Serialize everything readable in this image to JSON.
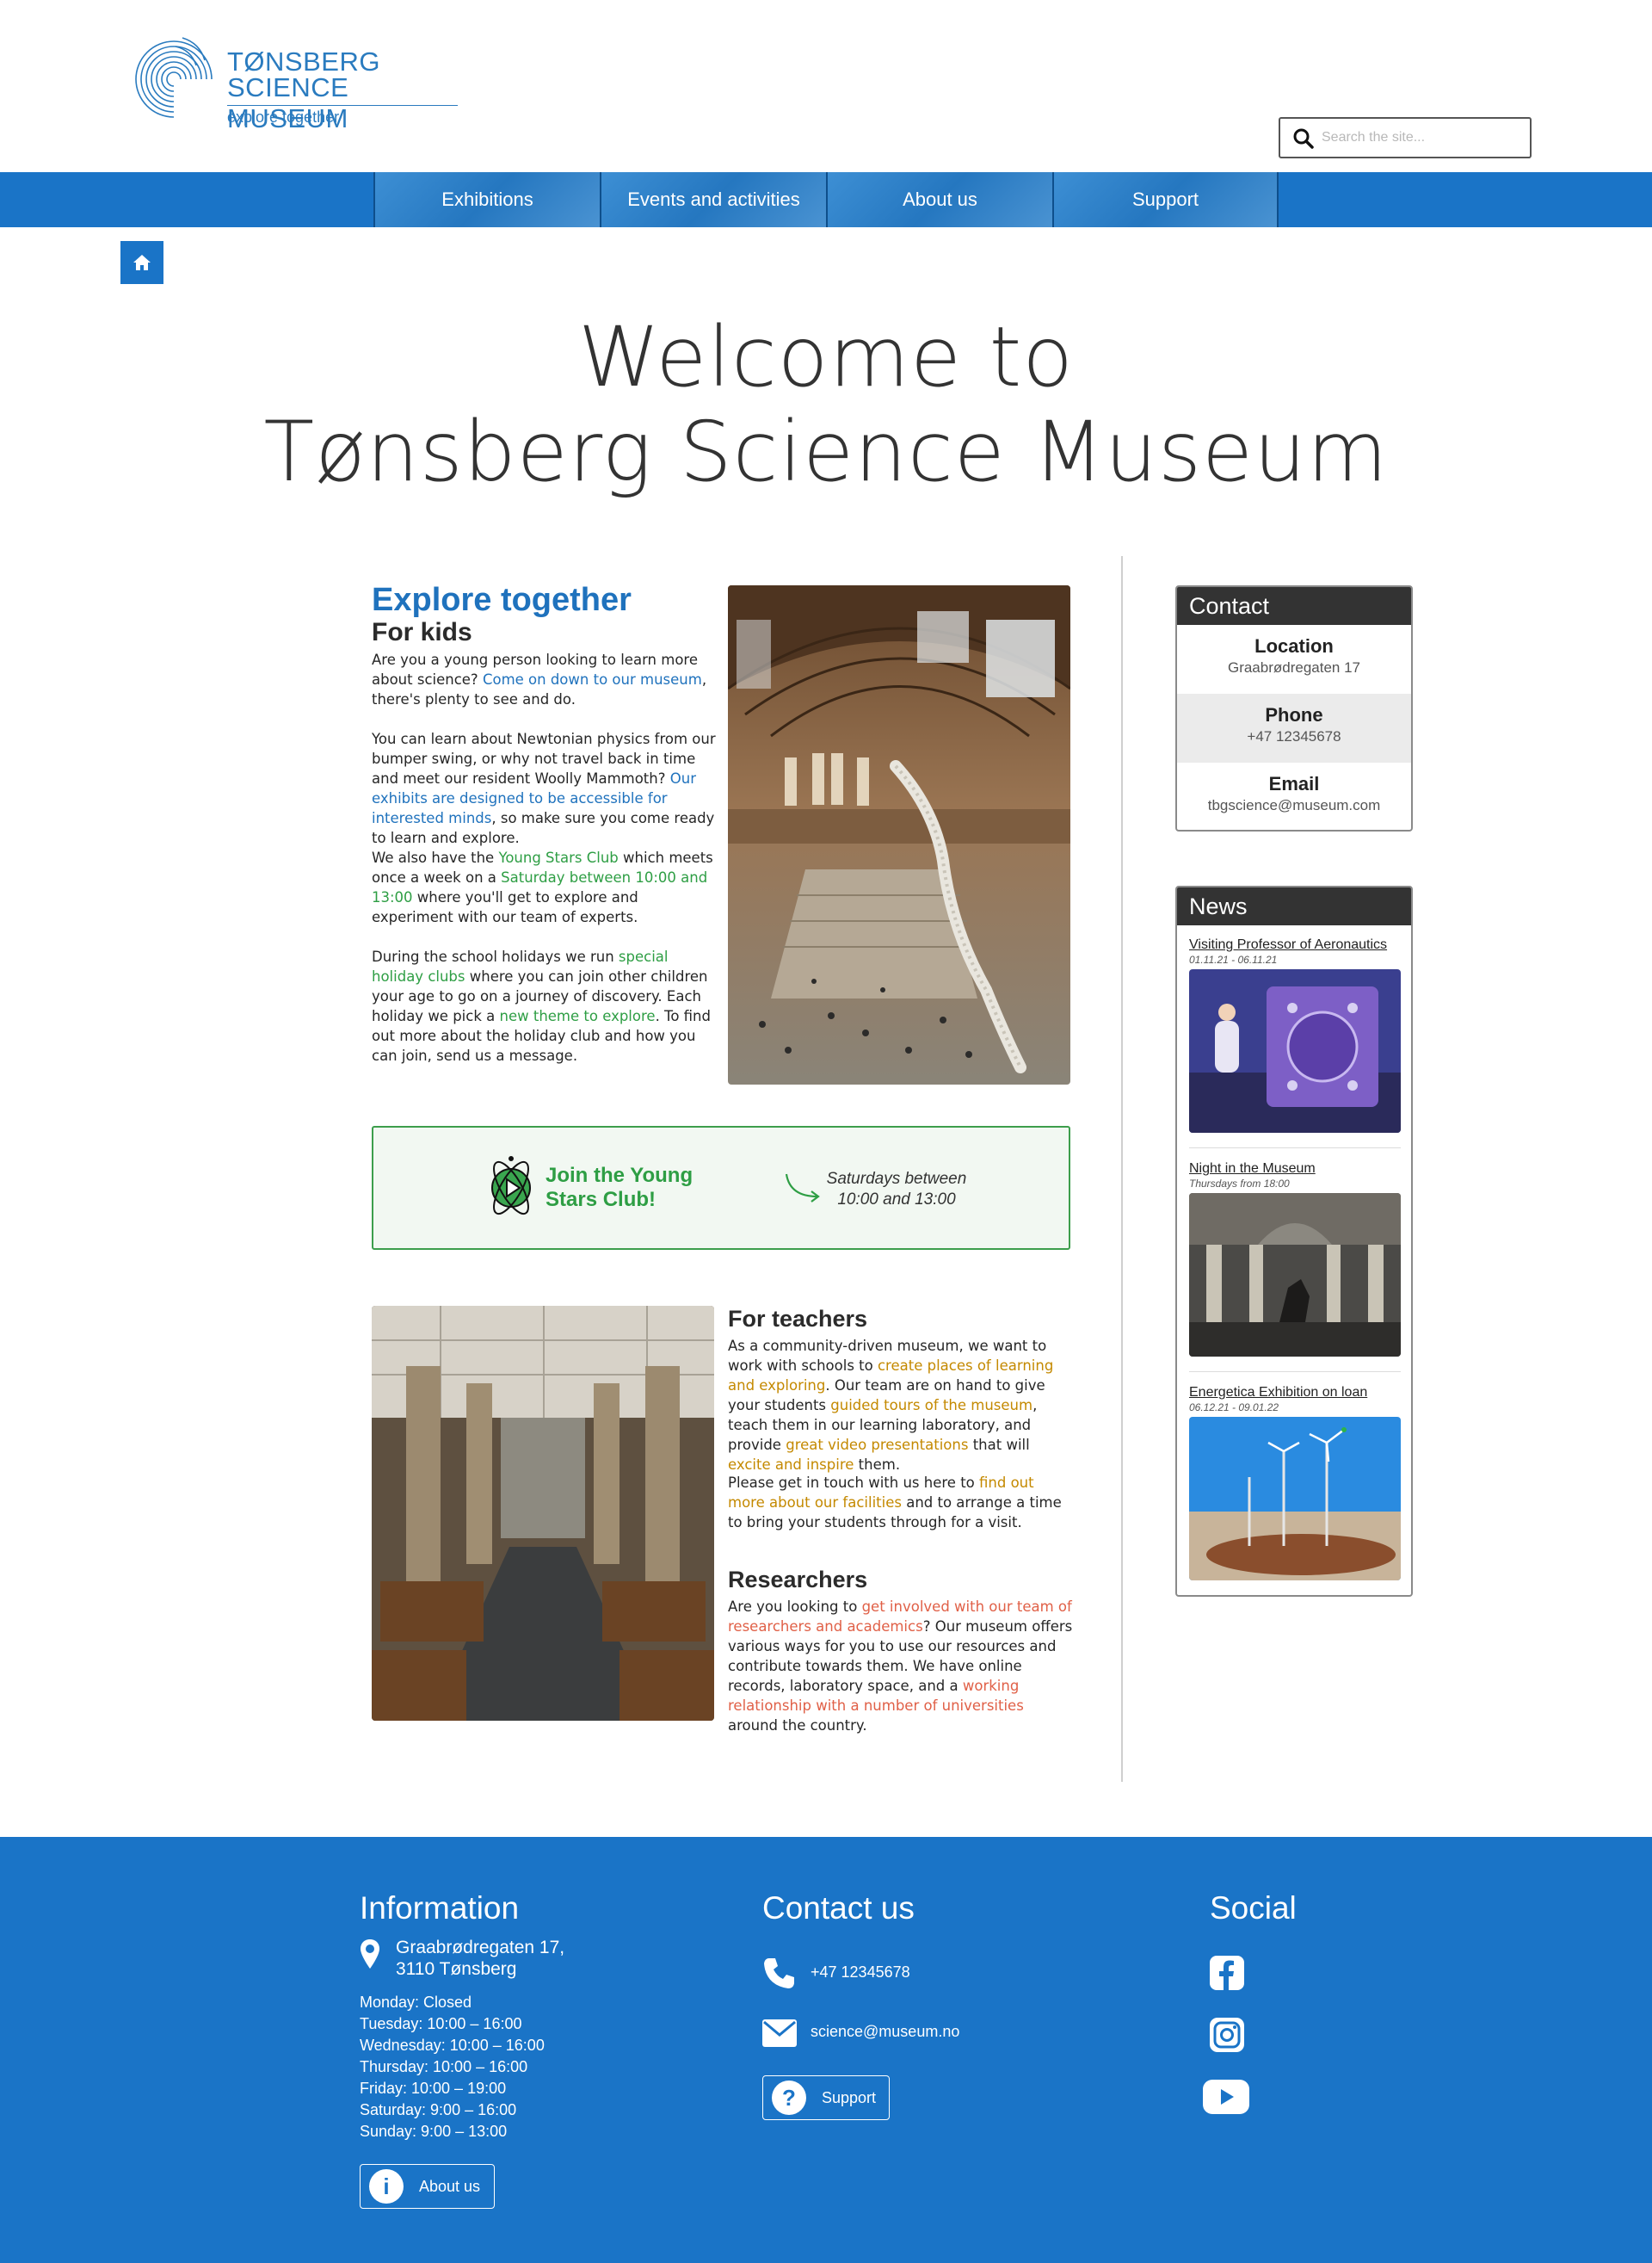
{
  "header": {
    "logo_line1": "TØNSBERG",
    "logo_line2": "SCIENCE MUSEUM",
    "logo_tagline": "explore together",
    "search_placeholder": "Search the site...",
    "search_icon": "search-icon"
  },
  "nav": {
    "items": [
      {
        "label": "Exhibitions"
      },
      {
        "label": "Events and activities"
      },
      {
        "label": "About us"
      },
      {
        "label": "Support"
      }
    ],
    "home_icon": "home-icon"
  },
  "title": {
    "line1": "Welcome to",
    "line2": "Tønsberg Science Museum"
  },
  "kids": {
    "heading": "Explore together",
    "subheading": "For kids",
    "p1_a": "Are you a young person looking to learn more about science? ",
    "p1_link": "Come on down to our museum",
    "p1_b": ", there's plenty to see and do.",
    "p2_a": "You can learn about Newtonian physics from our bumper swing, or why not travel back in time and meet our resident Woolly Mammoth? ",
    "p2_link": "Our exhibits are designed to be accessible for interested minds",
    "p2_b": ", so make sure you come ready to learn and explore.",
    "p3_a": "We also have the ",
    "p3_link1": "Young Stars Club",
    "p3_b": " which meets once a week on a ",
    "p3_link2": "Saturday between 10:00 and 13:00",
    "p3_c": " where you'll get to explore and experiment with our team of experts.",
    "p4_a": "During the school holidays we run ",
    "p4_link1": "special holiday clubs",
    "p4_b": " where you can join other children your age to go on a journey of discovery. Each holiday we pick a ",
    "p4_link2": "new theme to explore",
    "p4_c": ". To find out more about the holiday club and how you can join, send us a message."
  },
  "stars_club": {
    "title": "Join the Young Stars Club!",
    "time": "Saturdays between 10:00 and 13:00"
  },
  "teachers": {
    "heading": "For teachers",
    "p1_a": "As a community-driven museum, we want to work with schools to ",
    "p1_link1": "create places of learning and exploring",
    "p1_b": ". Our team are on hand to give your students ",
    "p1_link2": "guided tours of the museum",
    "p1_c": ", teach them in our learning laboratory, and provide ",
    "p1_link3": "great video presentations",
    "p1_d": " that will ",
    "p1_link4": "excite and inspire",
    "p1_e": " them.",
    "p2_a": "Please get in touch with us here to ",
    "p2_link": "find out more about our facilities",
    "p2_b": " and to arrange a time to bring your students through for a visit."
  },
  "researchers": {
    "heading": "Researchers",
    "p1_a": "Are you looking to ",
    "p1_link1": "get involved with our team of researchers and academics",
    "p1_b": "? Our museum offers various ways for you to use our resources and contribute towards them. We have online records, laboratory space, and a ",
    "p1_link2": "working relationship with a number of universities",
    "p1_c": " around the country."
  },
  "contact_panel": {
    "heading": "Contact",
    "rows": [
      {
        "label": "Location",
        "value": "Graabrødregaten 17"
      },
      {
        "label": "Phone",
        "value": "+47 12345678"
      },
      {
        "label": "Email",
        "value": "tbgscience@museum.com"
      }
    ]
  },
  "news_panel": {
    "heading": "News",
    "items": [
      {
        "title": "Visiting Professor of Aeronautics",
        "date": "01.11.21 - 06.11.21"
      },
      {
        "title": "Night in the Museum",
        "date": "Thursdays from 18:00"
      },
      {
        "title": "Energetica Exhibition on loan",
        "date": "06.12.21 - 09.01.22"
      }
    ]
  },
  "footer": {
    "info_heading": "Information",
    "address_line1": "Graabrødregaten 17,",
    "address_line2": "3110 Tønsberg",
    "hours": [
      "Monday: Closed",
      "Tuesday: 10:00 – 16:00",
      "Wednesday: 10:00 – 16:00",
      "Thursday: 10:00 – 16:00",
      "Friday: 10:00 – 19:00",
      "Saturday: 9:00 – 16:00",
      "Sunday: 9:00 – 13:00"
    ],
    "about_button": "About us",
    "contact_heading": "Contact us",
    "phone": "+47 12345678",
    "email": "science@museum.no",
    "support_button": "Support",
    "social_heading": "Social",
    "social_icons": [
      "facebook-icon",
      "instagram-icon",
      "youtube-icon"
    ]
  },
  "colors": {
    "brand_blue": "#1a74c7",
    "green": "#2e9e44",
    "gold": "#c48900",
    "coral": "#e06047"
  }
}
